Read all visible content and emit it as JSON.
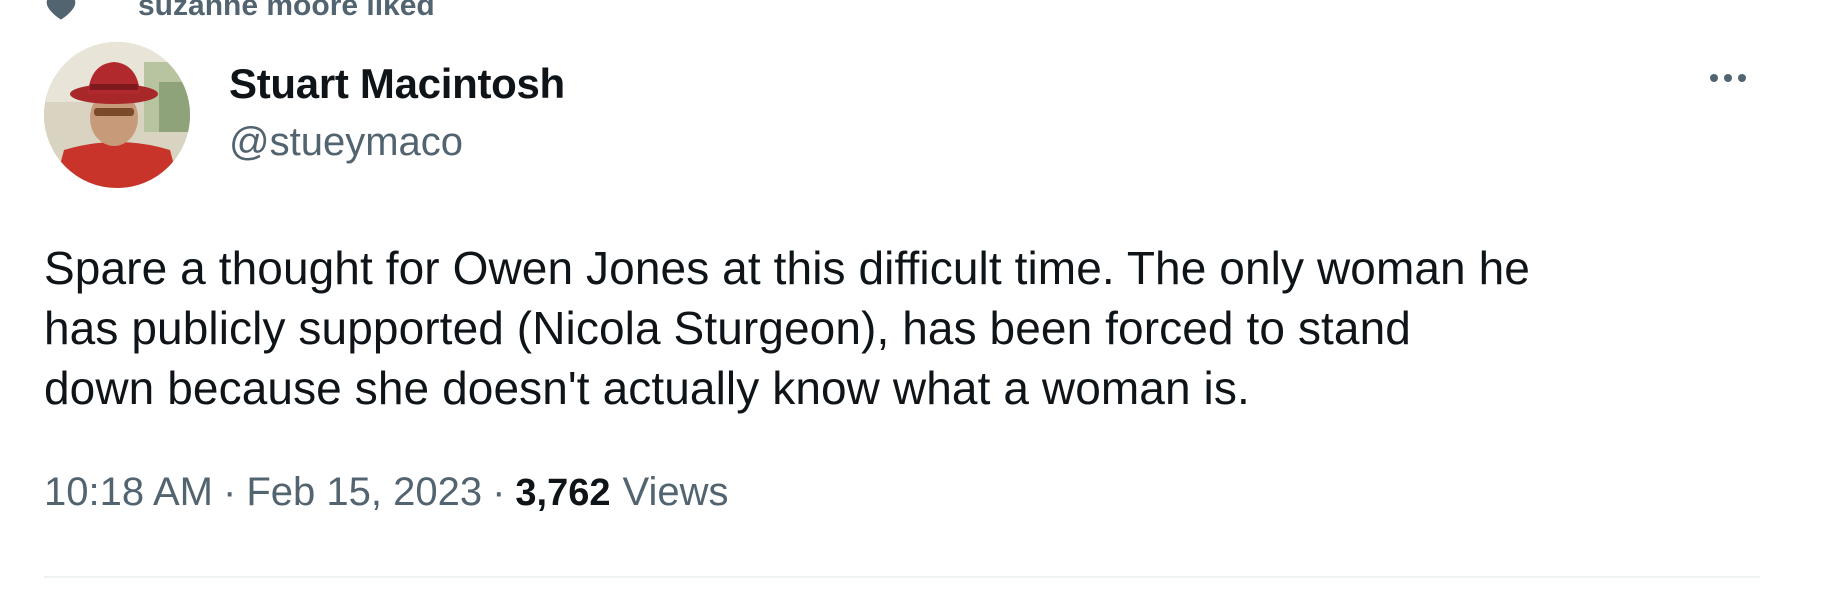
{
  "social_context": {
    "icon": "heart-icon",
    "text": "suzanne moore liked"
  },
  "author": {
    "avatar": "avatar-photo",
    "display_name": "Stuart Macintosh",
    "handle": "@stueymaco"
  },
  "more_button": {
    "icon": "more-horizontal-icon"
  },
  "tweet": {
    "lines": [
      "Spare a thought for Owen Jones at this difficult time. The only woman he",
      "has publicly supported (Nicola Sturgeon), has been forced to stand",
      "down because she doesn't actually know what a woman is."
    ]
  },
  "meta": {
    "time": "10:18 AM",
    "separator": "·",
    "date": "Feb 15, 2023",
    "views_count": "3,762",
    "views_label": "Views"
  },
  "colors": {
    "primary_text": "#0f1419",
    "secondary_text": "#536471",
    "divider": "#eff3f4"
  }
}
